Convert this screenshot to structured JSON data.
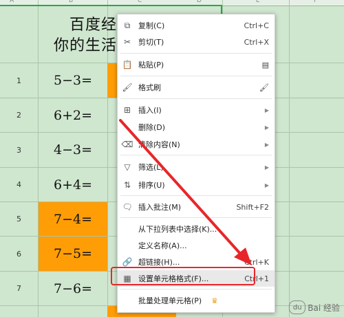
{
  "sheet": {
    "column_letters": [
      "A",
      "B",
      "C",
      "D",
      "E",
      "F"
    ],
    "title_line1": "百度经",
    "title_line2": "你的生活",
    "rows": [
      {
        "num": "1",
        "eq": "5−3=",
        "highlight": false
      },
      {
        "num": "2",
        "eq": "6+2=",
        "highlight": false
      },
      {
        "num": "3",
        "eq": "4−3=",
        "highlight": false
      },
      {
        "num": "4",
        "eq": "6+4=",
        "highlight": false
      },
      {
        "num": "5",
        "eq": "7−4=",
        "highlight": true
      },
      {
        "num": "6",
        "eq": "7−5=",
        "highlight": true
      },
      {
        "num": "7",
        "eq": "7−6=",
        "highlight": false
      }
    ]
  },
  "menu": {
    "items": [
      {
        "label": "复制(C)",
        "shortcut": "Ctrl+C",
        "icon": "copy-icon"
      },
      {
        "label": "剪切(T)",
        "shortcut": "Ctrl+X",
        "icon": "scissors-icon"
      },
      {
        "label": "粘贴(P)",
        "icon": "paste-icon"
      },
      {
        "label": "格式刷",
        "icon": "format-brush-icon"
      },
      {
        "label": "插入(I)",
        "icon": "insert-icon"
      },
      {
        "label": "删除(D)"
      },
      {
        "label": "清除内容(N)",
        "icon": "eraser-icon"
      },
      {
        "label": "筛选(L)",
        "icon": "filter-icon"
      },
      {
        "label": "排序(U)",
        "icon": "sort-icon"
      },
      {
        "label": "插入批注(M)",
        "shortcut": "Shift+F2",
        "icon": "comment-icon"
      },
      {
        "label": "从下拉列表中选择(K)..."
      },
      {
        "label": "定义名称(A)..."
      },
      {
        "label": "超链接(H)...",
        "shortcut": "Ctrl+K",
        "icon": "link-icon"
      },
      {
        "label": "设置单元格格式(F)...",
        "shortcut": "Ctrl+1",
        "icon": "format-cells-icon"
      },
      {
        "label": "批量处理单元格(P)",
        "icon": "crown-icon"
      }
    ]
  },
  "watermark": {
    "text": "Bai 经验",
    "paw": "du"
  },
  "colors": {
    "orange": "#ff9d07",
    "sheet_bg": "#cfe6cf",
    "annotation_red": "#e8262a"
  }
}
